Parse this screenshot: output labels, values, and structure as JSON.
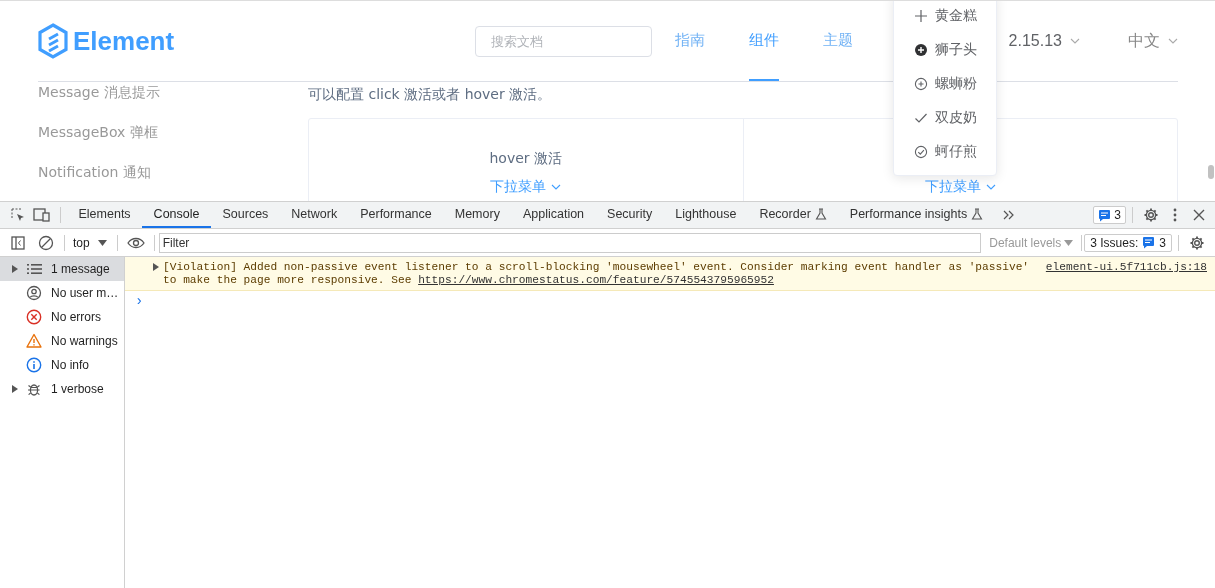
{
  "site": {
    "logo": "Element",
    "search": {
      "placeholder": "搜索文档"
    },
    "nav": [
      {
        "label": "指南",
        "selected": false
      },
      {
        "label": "组件",
        "selected": true
      },
      {
        "label": "主题",
        "selected": false
      }
    ],
    "version": "2.15.13",
    "language": "中文",
    "sidebar": [
      "Message 消息提示",
      "MessageBox 弹框",
      "Notification 通知"
    ],
    "description": "可以配置 click 激活或者 hover 激活。",
    "demos": [
      {
        "title": "hover 激活",
        "trigger": "下拉菜单"
      },
      {
        "trigger": "下拉菜单"
      }
    ],
    "dropdown": [
      {
        "kind": "plus",
        "label": "黄金糕"
      },
      {
        "kind": "plus-filled",
        "label": "狮子头"
      },
      {
        "kind": "plus-outline",
        "label": "螺蛳粉"
      },
      {
        "kind": "check",
        "label": "双皮奶"
      },
      {
        "kind": "check-outline",
        "label": "蚵仔煎"
      }
    ]
  },
  "devtools": {
    "tabs": [
      {
        "label": "Elements",
        "selected": false,
        "experimental": false
      },
      {
        "label": "Console",
        "selected": true,
        "experimental": false
      },
      {
        "label": "Sources",
        "selected": false,
        "experimental": false
      },
      {
        "label": "Network",
        "selected": false,
        "experimental": false
      },
      {
        "label": "Performance",
        "selected": false,
        "experimental": false
      },
      {
        "label": "Memory",
        "selected": false,
        "experimental": false
      },
      {
        "label": "Application",
        "selected": false,
        "experimental": false
      },
      {
        "label": "Security",
        "selected": false,
        "experimental": false
      },
      {
        "label": "Lighthouse",
        "selected": false,
        "experimental": false
      },
      {
        "label": "Recorder",
        "selected": false,
        "experimental": true
      },
      {
        "label": "Performance insights",
        "selected": false,
        "experimental": true
      }
    ],
    "issues_badge": "3",
    "context": "top",
    "filter": {
      "placeholder": "Filter"
    },
    "levels": "Default levels",
    "issues_label": "3 Issues:",
    "issues_count": "3",
    "sidebar": [
      {
        "kind": "list",
        "label": "1 message",
        "selected": true,
        "expandable": true
      },
      {
        "kind": "user",
        "label": "No user m…",
        "selected": false,
        "expandable": false
      },
      {
        "kind": "error",
        "label": "No errors",
        "selected": false,
        "expandable": false
      },
      {
        "kind": "warning",
        "label": "No warnings",
        "selected": false,
        "expandable": false
      },
      {
        "kind": "info",
        "label": "No info",
        "selected": false,
        "expandable": false
      },
      {
        "kind": "verbose",
        "label": "1 verbose",
        "selected": false,
        "expandable": true
      }
    ],
    "messages": [
      {
        "text": "[Violation] Added non-passive event listener to a scroll-blocking 'mousewheel' event. Consider marking event handler as 'passive'",
        "text2": "to make the page more responsive. See ",
        "link": "https://www.chromestatus.com/feature/5745543795965952",
        "source": "element-ui.5f711cb.js:18"
      }
    ],
    "prompt": "›"
  }
}
